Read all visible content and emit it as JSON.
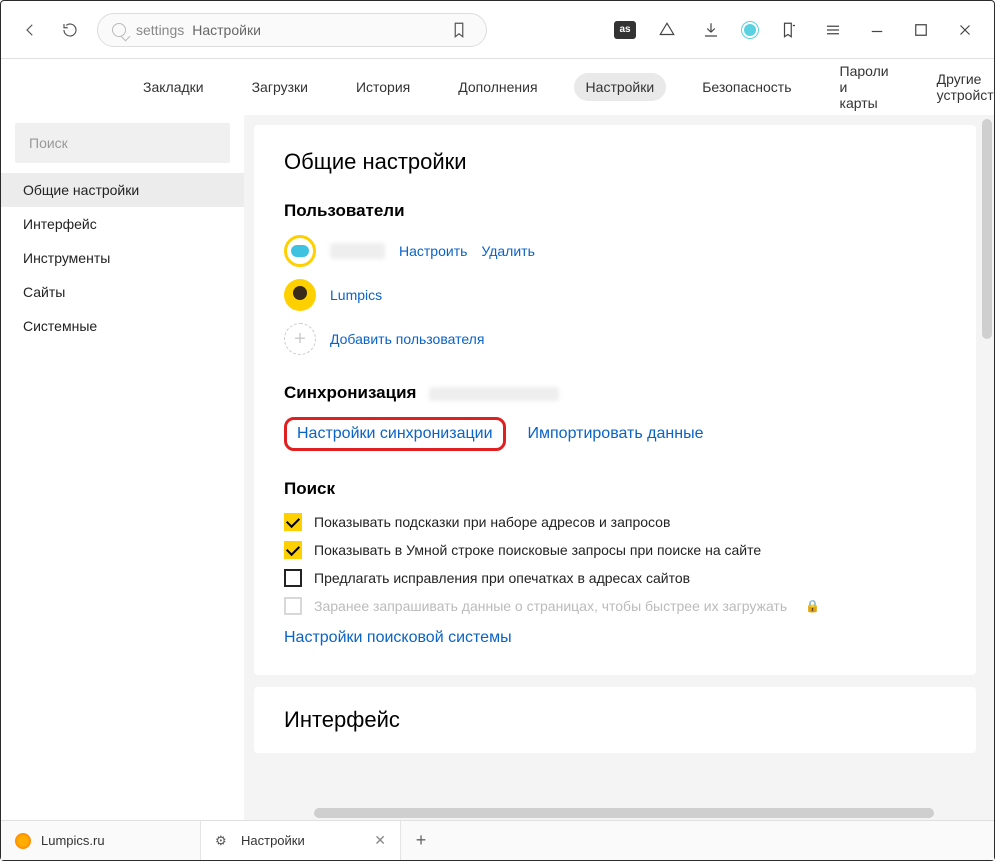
{
  "toolbar": {
    "address_scheme": "settings",
    "address_title": "Настройки",
    "lastfm_label": "as"
  },
  "topnav": {
    "tabs": [
      "Закладки",
      "Загрузки",
      "История",
      "Дополнения",
      "Настройки",
      "Безопасность",
      "Пароли и карты",
      "Другие устройства"
    ],
    "active_index": 4
  },
  "sidebar": {
    "search_placeholder": "Поиск",
    "items": [
      "Общие настройки",
      "Интерфейс",
      "Инструменты",
      "Сайты",
      "Системные"
    ],
    "active_index": 0
  },
  "content": {
    "heading": "Общие настройки",
    "users": {
      "section_title": "Пользователи",
      "configure": "Настроить",
      "remove": "Удалить",
      "user2_name": "Lumpics",
      "add_user": "Добавить пользователя"
    },
    "sync": {
      "section_title": "Синхронизация",
      "settings_link": "Настройки синхронизации",
      "import_link": "Импортировать данные"
    },
    "search": {
      "section_title": "Поиск",
      "opt1": "Показывать подсказки при наборе адресов и запросов",
      "opt2": "Показывать в Умной строке поисковые запросы при поиске на сайте",
      "opt3": "Предлагать исправления при опечатках в адресах сайтов",
      "opt4": "Заранее запрашивать данные о страницах, чтобы быстрее их загружать",
      "engine_link": "Настройки поисковой системы"
    },
    "next_section": "Интерфейс"
  },
  "tabstrip": {
    "tab1": "Lumpics.ru",
    "tab2": "Настройки"
  }
}
